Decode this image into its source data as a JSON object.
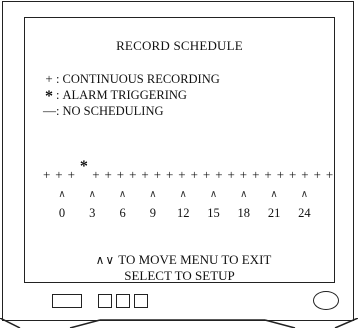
{
  "screen": {
    "title": "RECORD SCHEDULE",
    "legend": [
      {
        "symbol": "+",
        "icon": "plus-icon",
        "text": "CONTINUOUS RECORDING"
      },
      {
        "symbol": "*",
        "icon": "asterisk-icon",
        "text": "ALARM TRIGGERING"
      },
      {
        "symbol": "—",
        "icon": "dash-icon",
        "text": "NO SCHEDULING"
      }
    ],
    "legend_separator": ":",
    "timeline": {
      "marks": [
        "+",
        "+",
        "+",
        "*",
        "+",
        "+",
        "+",
        "+",
        "+",
        "+",
        "+",
        "+",
        "+",
        "+",
        "+",
        "+",
        "+",
        "+",
        "+",
        "+",
        "+",
        "+",
        "+",
        "+"
      ],
      "caret_symbol": "∧",
      "hours": [
        "0",
        "3",
        "6",
        "9",
        "12",
        "15",
        "18",
        "21",
        "24"
      ]
    },
    "instructions": {
      "arrows": "∧∨",
      "line1": "TO MOVE  MENU TO EXIT",
      "line2": "SELECT TO SETUP"
    }
  }
}
